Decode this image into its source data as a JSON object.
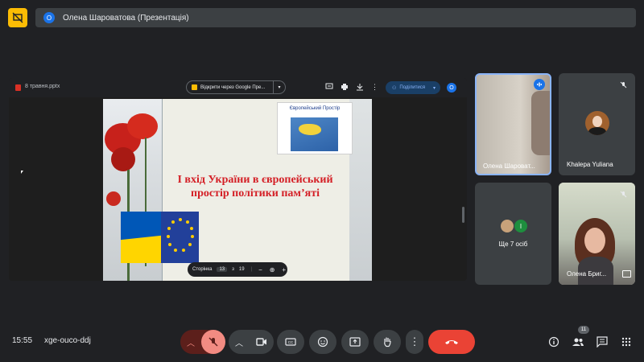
{
  "top_bar": {
    "presenter_initial": "O",
    "presenter_banner": "Олена Шароватова (Презентація)"
  },
  "share": {
    "file_name": "8 травня.pptx",
    "open_with": "Відкрити через Google Пре...",
    "share_label": "Поділитися",
    "user_initial": "O"
  },
  "slide": {
    "eu_box_title": "Європейський Простір",
    "title": "І вхід України в європейський простір політики пам’яті",
    "page_label": "Сторінка",
    "page_current": "13",
    "page_of": "з",
    "page_total": "19"
  },
  "tiles": {
    "p1_name": "Олена Шароват...",
    "p2_name": "Khalepa Yuliana",
    "others_label": "Ще 7 осіб",
    "others_initial": "I",
    "p3_name": "Олена Бриг..."
  },
  "bottom": {
    "time": "15:55",
    "meeting_code": "xge-ouco-ddj",
    "participants_count": "11"
  },
  "colors": {
    "background": "#202124",
    "accent_blue": "#1a73e8",
    "mic_off_red": "#f28b82",
    "end_call_red": "#ea4335",
    "present_yellow": "#fbbc04",
    "slide_title_red": "#d41f26"
  }
}
